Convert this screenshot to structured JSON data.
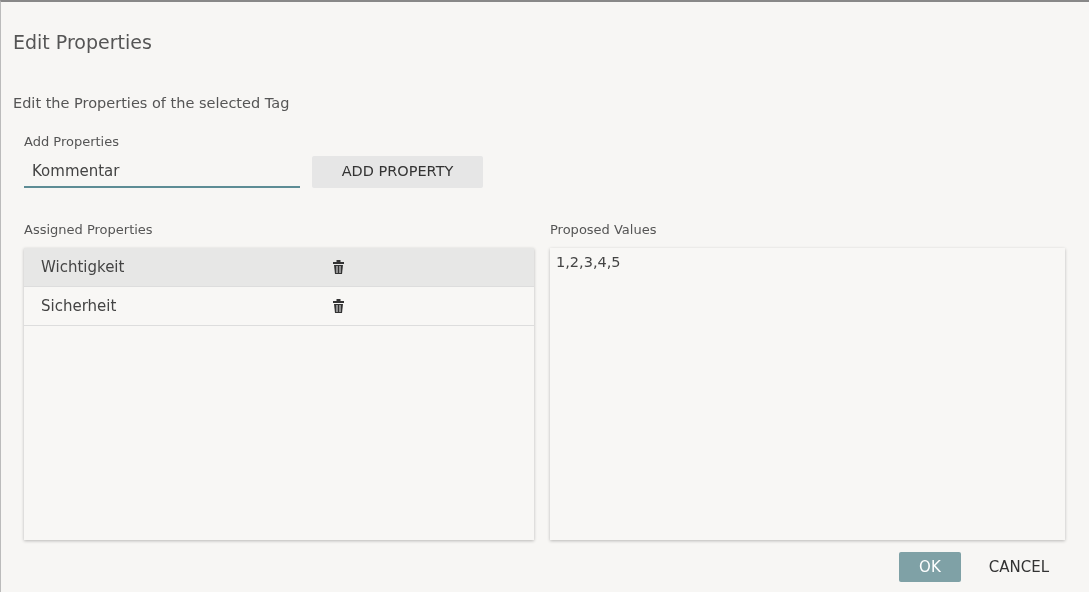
{
  "dialog": {
    "title": "Edit Properties",
    "description": "Edit the Properties of the selected Tag"
  },
  "add_properties": {
    "label": "Add Properties",
    "value": "Kommentar",
    "button": "ADD PROPERTY"
  },
  "assigned_properties": {
    "label": "Assigned Properties",
    "items": [
      {
        "name": "Wichtigkeit",
        "selected": true
      },
      {
        "name": "Sicherheit",
        "selected": false
      }
    ]
  },
  "proposed_values": {
    "label": "Proposed Values",
    "value": "1,2,3,4,5"
  },
  "buttons": [
    {
      "label": "OK",
      "kind": "primary"
    },
    {
      "label": "CANCEL",
      "kind": "flat"
    }
  ]
}
